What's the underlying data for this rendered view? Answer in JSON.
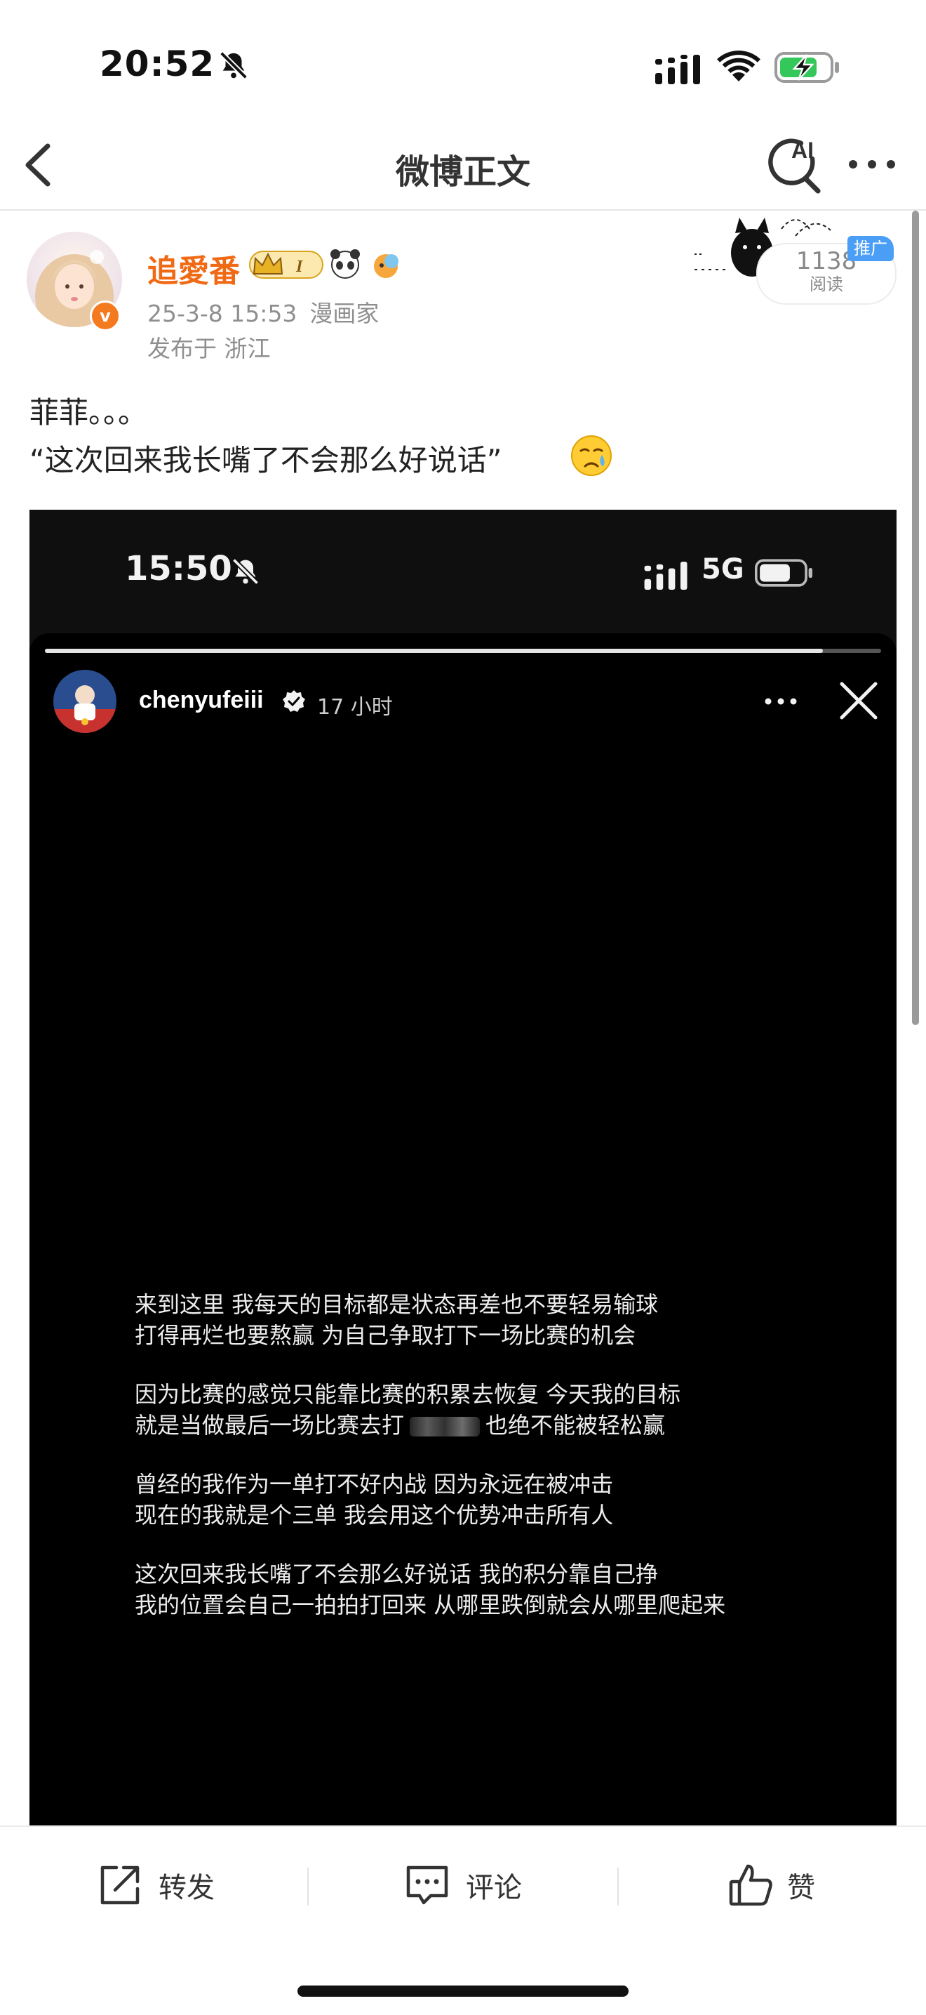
{
  "status_bar": {
    "time": "20:52",
    "icons": [
      "bell-slash-icon",
      "cellular-signal-icon",
      "wifi-icon",
      "battery-charging-icon"
    ]
  },
  "nav": {
    "title": "微博正文",
    "ai_label": "AI",
    "icons": [
      "back-chevron-icon",
      "ai-search-icon",
      "more-dots-icon"
    ]
  },
  "post": {
    "author": "追愛番",
    "date": "25-3-8 15:53",
    "source": "漫画家",
    "location": "发布于 浙江",
    "reads": "1138",
    "reads_label": "阅读",
    "promo_tag": "推广",
    "text_line1": "菲菲。。。",
    "text_line2": "“这次回来我长嘴了不会那么好说话”",
    "emoji": "crying-face-emoji"
  },
  "embedded_story": {
    "status_time": "15:50",
    "network": "5G",
    "username": "chenyufeiii",
    "time_ago": "17 小时",
    "progress": 0.93,
    "lines": [
      "来到这里 我每天的目标都是状态再差也不要轻易输球",
      "打得再烂也要熬赢 为自己争取打下一场比赛的机会",
      "因为比赛的感觉只能靠比赛的积累去恢复 今天我的目标",
      "就是当做最后一场比赛去打",
      "也绝不能被轻松赢",
      "曾经的我作为一单打不好内战 因为永远在被冲击",
      "现在的我就是个三单 我会用这个优势冲击所有人",
      "这次回来我长嘴了不会那么好说话 我的积分靠自己挣",
      "我的位置会自己一拍拍打回来 从哪里跌倒就会从哪里爬起来"
    ]
  },
  "actions": {
    "repost": "转发",
    "comment": "评论",
    "like": "赞"
  },
  "colors": {
    "username": "#f06a15",
    "promo": "#4a9ef5",
    "meta": "#8f8f8f"
  }
}
